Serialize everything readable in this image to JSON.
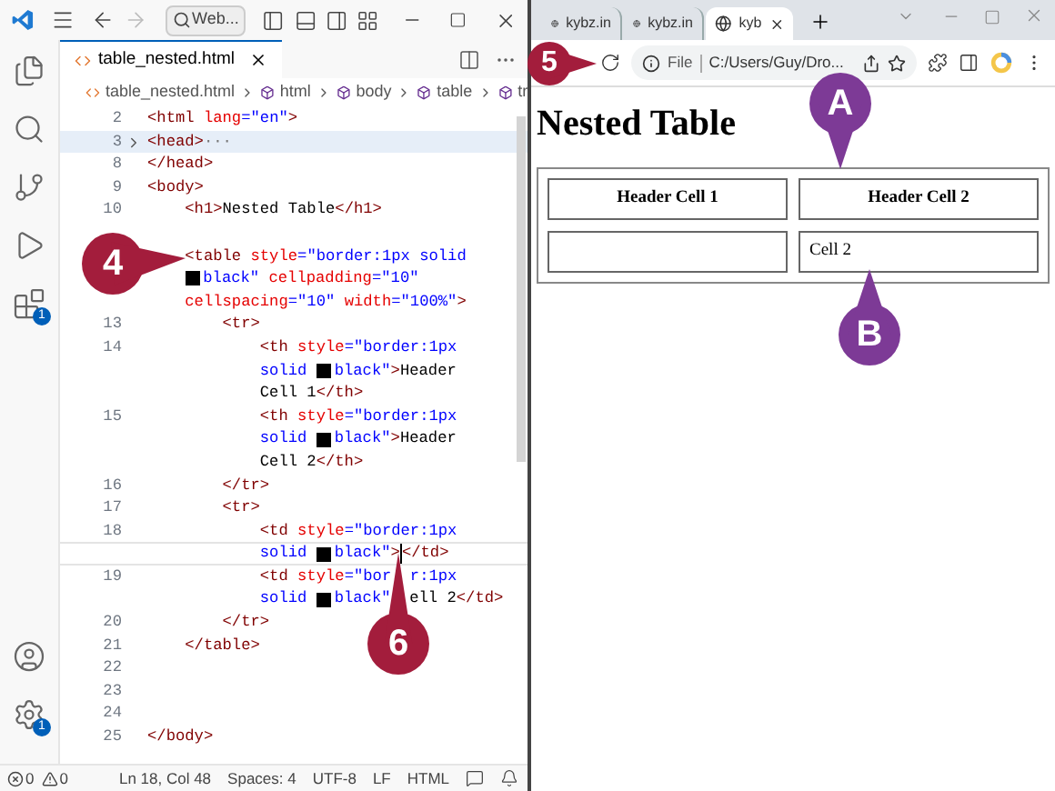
{
  "editor": {
    "title_bar": {
      "search": "Web..."
    },
    "tab": {
      "label": "table_nested.html",
      "selected": true
    },
    "breadcrumbs": [
      "table_nested.html",
      "html",
      "body",
      "table",
      "tr"
    ],
    "activity_badges": {
      "extensions": "1",
      "settings": "1"
    },
    "lines": [
      {
        "number": "2",
        "hovered": false,
        "current": false,
        "tokens": [
          {
            "kind": "tag",
            "text": "<html "
          },
          {
            "kind": "attr",
            "text": "lang"
          },
          {
            "kind": "value",
            "text": "=\"en\""
          },
          {
            "kind": "tag",
            "text": ">"
          }
        ]
      },
      {
        "number": "3",
        "hovered": true,
        "current": false,
        "tokens": [
          {
            "kind": "fold"
          },
          {
            "kind": "tag",
            "text": "<head>"
          },
          {
            "kind": "ellipsis",
            "text": "···"
          }
        ]
      },
      {
        "number": "8",
        "hovered": false,
        "current": false,
        "tokens": [
          {
            "kind": "tag",
            "text": "</head>"
          }
        ]
      },
      {
        "number": "9",
        "hovered": false,
        "current": false,
        "tokens": [
          {
            "kind": "tag",
            "text": "<body>"
          }
        ]
      },
      {
        "number": "10",
        "hovered": false,
        "current": false,
        "tokens": [
          {
            "kind": "tag",
            "text": "    <h1>"
          },
          {
            "kind": "text",
            "text": "Nested Table"
          },
          {
            "kind": "tag",
            "text": "</h1>"
          }
        ]
      },
      {
        "hovered": false,
        "current": false
      },
      {
        "hovered": false,
        "current": false,
        "tokens": [
          {
            "kind": "tag",
            "text": "    <table "
          },
          {
            "kind": "attr",
            "text": "style"
          },
          {
            "kind": "value",
            "text": "=\"border:1px solid"
          }
        ]
      },
      {
        "hovered": false,
        "current": false,
        "tokens": [
          {
            "kind": "swatch"
          },
          {
            "kind": "value",
            "text": "black\" "
          },
          {
            "kind": "attr",
            "text": "cellpadding"
          },
          {
            "kind": "value",
            "text": "=\"10\""
          }
        ]
      },
      {
        "hovered": false,
        "current": false,
        "tokens": [
          {
            "kind": "attr",
            "text": "cellspacing"
          },
          {
            "kind": "value",
            "text": "=\"10\" "
          },
          {
            "kind": "attr",
            "text": "width"
          },
          {
            "kind": "value",
            "text": "=\"100%\""
          },
          {
            "kind": "tag",
            "text": ">"
          }
        ]
      },
      {
        "number": "13",
        "hovered": false,
        "current": false,
        "tokens": [
          {
            "kind": "tag",
            "text": "        <tr>"
          }
        ]
      },
      {
        "number": "14",
        "hovered": false,
        "current": false,
        "tokens": [
          {
            "kind": "tag",
            "text": "            <th "
          },
          {
            "kind": "attr",
            "text": "style"
          },
          {
            "kind": "value",
            "text": "=\"border:1px"
          }
        ]
      },
      {
        "hovered": false,
        "current": false,
        "tokens": [
          {
            "kind": "value",
            "text": "solid "
          },
          {
            "kind": "swatch"
          },
          {
            "kind": "value",
            "text": "black\""
          },
          {
            "kind": "tag",
            "text": ">"
          },
          {
            "kind": "text",
            "text": "Header"
          }
        ]
      },
      {
        "hovered": false,
        "current": false,
        "tokens": [
          {
            "kind": "text",
            "text": "Cell 1"
          },
          {
            "kind": "tag",
            "text": "</th>"
          }
        ]
      },
      {
        "number": "15",
        "hovered": false,
        "current": false,
        "tokens": [
          {
            "kind": "tag",
            "text": "            <th "
          },
          {
            "kind": "attr",
            "text": "style"
          },
          {
            "kind": "value",
            "text": "=\"border:1px"
          }
        ]
      },
      {
        "hovered": false,
        "current": false,
        "tokens": [
          {
            "kind": "value",
            "text": "solid "
          },
          {
            "kind": "swatch"
          },
          {
            "kind": "value",
            "text": "black\""
          },
          {
            "kind": "tag",
            "text": ">"
          },
          {
            "kind": "text",
            "text": "Header"
          }
        ]
      },
      {
        "hovered": false,
        "current": false,
        "tokens": [
          {
            "kind": "text",
            "text": "Cell 2"
          },
          {
            "kind": "tag",
            "text": "</th>"
          }
        ]
      },
      {
        "number": "16",
        "hovered": false,
        "current": false,
        "tokens": [
          {
            "kind": "tag",
            "text": "        </tr>"
          }
        ]
      },
      {
        "number": "17",
        "hovered": false,
        "current": false,
        "tokens": [
          {
            "kind": "tag",
            "text": "        <tr>"
          }
        ]
      },
      {
        "number": "18",
        "hovered": false,
        "current": false,
        "tokens": [
          {
            "kind": "tag",
            "text": "            <td "
          },
          {
            "kind": "attr",
            "text": "style"
          },
          {
            "kind": "value",
            "text": "=\"border:1px"
          }
        ]
      },
      {
        "hovered": false,
        "current": true,
        "tokens": [
          {
            "kind": "value",
            "text": "solid "
          },
          {
            "kind": "swatch"
          },
          {
            "kind": "value",
            "text": "black\""
          },
          {
            "kind": "tag",
            "text": ">"
          },
          {
            "kind": "cursor"
          },
          {
            "kind": "tag",
            "text": "</td>"
          }
        ]
      },
      {
        "number": "19",
        "hovered": false,
        "current": false,
        "tokens": [
          {
            "kind": "tag",
            "text": "            <td "
          },
          {
            "kind": "attr",
            "text": "style"
          },
          {
            "kind": "value",
            "text": "=\"bor"
          },
          {
            "kind": "gap"
          },
          {
            "kind": "value",
            "text": "r:1px"
          }
        ]
      },
      {
        "hovered": false,
        "current": false,
        "tokens": [
          {
            "kind": "value",
            "text": "solid "
          },
          {
            "kind": "swatch"
          },
          {
            "kind": "value",
            "text": "black\""
          },
          {
            "kind": "gap"
          },
          {
            "kind": "text",
            "text": "ell 2"
          },
          {
            "kind": "tag",
            "text": "</td>"
          }
        ]
      },
      {
        "number": "20",
        "hovered": false,
        "current": false,
        "tokens": [
          {
            "kind": "tag",
            "text": "        </tr>"
          }
        ]
      },
      {
        "number": "21",
        "hovered": false,
        "current": false,
        "tokens": [
          {
            "kind": "tag",
            "text": "    </table>"
          }
        ]
      },
      {
        "number": "22",
        "hovered": false,
        "current": false
      },
      {
        "number": "23",
        "hovered": false,
        "current": false
      },
      {
        "number": "24",
        "hovered": false,
        "current": false
      },
      {
        "number": "25",
        "hovered": false,
        "current": false,
        "tokens": [
          {
            "kind": "tag",
            "text": "</body>"
          }
        ]
      }
    ],
    "status_bar": {
      "errors": "0",
      "warnings": "0",
      "items": [
        "Ln 18, Col 48",
        "Spaces: 4",
        "UTF-8",
        "LF",
        "HTML"
      ]
    }
  },
  "browser": {
    "tabs": [
      {
        "label": "kybz.in",
        "selected": false
      },
      {
        "label": "kybz.in",
        "selected": false
      },
      {
        "label": "kyb",
        "selected": true
      }
    ],
    "address": {
      "scheme": "File",
      "url": "C:/Users/Guy/Dro..."
    },
    "page": {
      "heading": "Nested Table",
      "headers": [
        "Header Cell 1",
        "Header Cell 2"
      ],
      "rows": [
        [
          null,
          "Cell 2"
        ]
      ]
    }
  },
  "callouts": [
    {
      "label": "4",
      "color": "#a31d3c"
    },
    {
      "label": "5",
      "color": "#a31d3c"
    },
    {
      "label": "6",
      "color": "#a31d3c"
    },
    {
      "label": "A",
      "color": "#7d3a96"
    },
    {
      "label": "B",
      "color": "#7d3a96"
    }
  ]
}
